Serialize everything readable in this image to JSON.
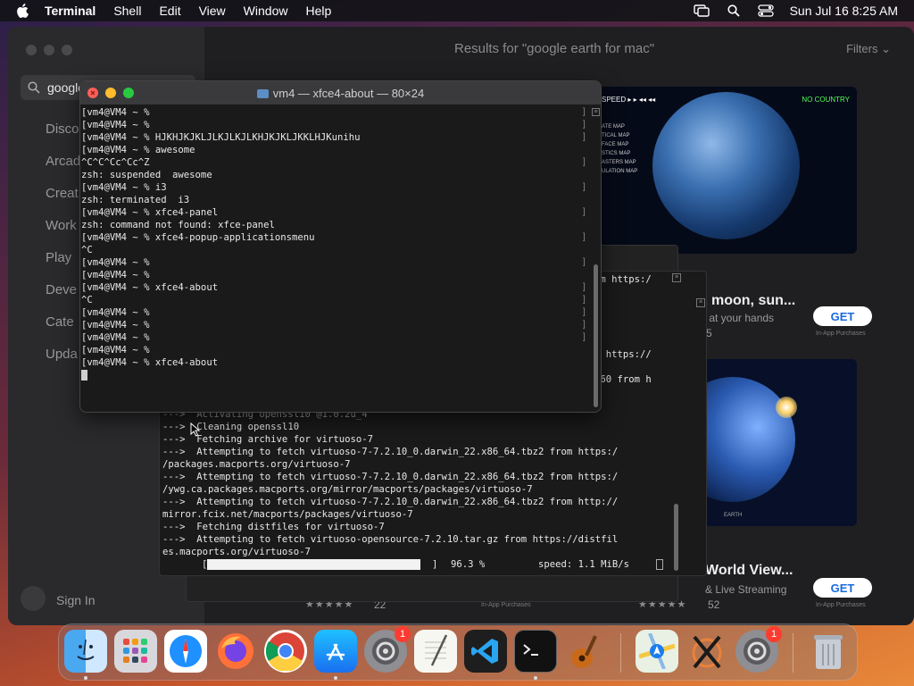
{
  "menubar": {
    "app_name": "Terminal",
    "items": [
      "Shell",
      "Edit",
      "View",
      "Window",
      "Help"
    ],
    "clock": "Sun Jul 16  8:25 AM"
  },
  "appstore": {
    "search_value": "google",
    "nav": [
      "Disco",
      "Arcad",
      "Creat",
      "Work",
      "Play",
      "Deve",
      "Cate",
      "Upda"
    ],
    "sign_in": "Sign In",
    "results_title": "Results for \"google earth for mac\"",
    "filters": "Filters",
    "card1": {
      "label_speed": "SPEED",
      "label_country": "NO COUNTRY",
      "menu_items": [
        "ATE MAP",
        "TICAL MAP",
        "FACE MAP",
        "STICS MAP",
        "ASTERS MAP",
        "ULATION MAP"
      ],
      "title": "& moon, sun...",
      "subtitle": "et at your hands",
      "rating_count": "5",
      "get": "GET",
      "iap": "In-App Purchases"
    },
    "card2": {
      "label": "EARTH",
      "title": "World View...",
      "subtitle": "& Live Streaming",
      "rating_count": "52",
      "get": "GET",
      "iap": "In-App Purchases"
    },
    "bottom_left": {
      "rating_count": "22",
      "iap": "In-App Purchases"
    }
  },
  "terminal_main": {
    "title": "vm4 — xfce4-about — 80×24",
    "lines": [
      "[vm4@VM4 ~ %",
      "[vm4@VM4 ~ %",
      "[vm4@VM4 ~ % HJKHJKJKLJLKJLKJLKHJKJKLJKKLHJKunihu",
      "[vm4@VM4 ~ % awesome",
      "^C^C^Cc^Cc^Z",
      "zsh: suspended  awesome",
      "[vm4@VM4 ~ % i3",
      "zsh: terminated  i3",
      "[vm4@VM4 ~ % xfce4-panel",
      "zsh: command not found: xfce-panel",
      "[vm4@VM4 ~ % xfce4-popup-applicationsmenu",
      "^C",
      "[vm4@VM4 ~ %",
      "[vm4@VM4 ~ %",
      "[vm4@VM4 ~ % xfce4-about",
      "^C",
      "[vm4@VM4 ~ %",
      "[vm4@VM4 ~ %",
      "[vm4@VM4 ~ %",
      "[vm4@VM4 ~ %",
      "[vm4@VM4 ~ % xfce4-about"
    ]
  },
  "terminal_back": {
    "side_lines": [
      "om https:/",
      "m https://",
      "160 from h"
    ],
    "lines": [
      "--->  Activating openssl10 @1.0.2u_4",
      "--->  Cleaning openssl10",
      "--->  Fetching archive for virtuoso-7",
      "--->  Attempting to fetch virtuoso-7-7.2.10_0.darwin_22.x86_64.tbz2 from https:/",
      "/packages.macports.org/virtuoso-7",
      "--->  Attempting to fetch virtuoso-7-7.2.10_0.darwin_22.x86_64.tbz2 from https:/",
      "/ywg.ca.packages.macports.org/mirror/macports/packages/virtuoso-7",
      "--->  Attempting to fetch virtuoso-7-7.2.10_0.darwin_22.x86_64.tbz2 from http://",
      "mirror.fcix.net/macports/packages/virtuoso-7",
      "--->  Fetching distfiles for virtuoso-7",
      "--->  Attempting to fetch virtuoso-opensource-7.2.10.tar.gz from https://distfil",
      "es.macports.org/virtuoso-7"
    ],
    "progress_percent": "96.3 %",
    "speed": "speed: 1.1 MiB/s",
    "progress_value": 0.963
  },
  "dock": {
    "badge1": "1",
    "badge2": "1"
  }
}
